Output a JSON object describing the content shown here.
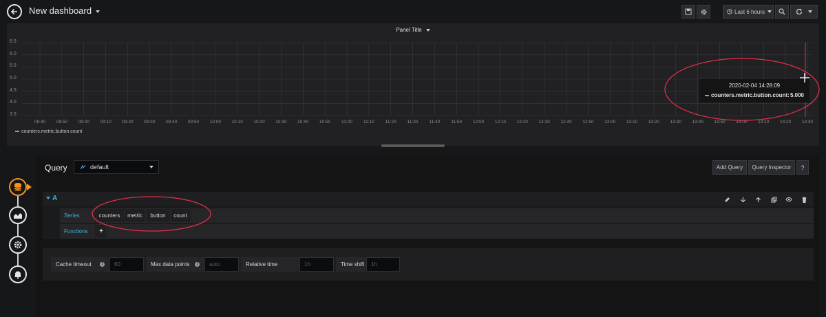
{
  "header": {
    "title": "New dashboard",
    "time_range": "Last 6 hours",
    "icons": [
      "save-icon",
      "gear-icon",
      "clock-icon",
      "zoom-out-icon",
      "refresh-icon"
    ]
  },
  "panel": {
    "title": "Panel Title",
    "legend": "counters.metric.button.count",
    "tooltip": {
      "time": "2020-02-04 14:28:09",
      "series": "counters.metric.button.count:",
      "value": "5.000"
    }
  },
  "chart_data": {
    "type": "line",
    "series": [
      {
        "name": "counters.metric.button.count",
        "x": [
          "14:28"
        ],
        "values": [
          5.0
        ]
      }
    ],
    "y_ticks": [
      "6.5",
      "6.0",
      "5.5",
      "5.0",
      "4.5",
      "4.0",
      "3.5"
    ],
    "x_ticks": [
      "08:40",
      "08:50",
      "09:00",
      "09:10",
      "09:20",
      "09:30",
      "09:40",
      "09:50",
      "10:00",
      "10:10",
      "10:20",
      "10:30",
      "10:40",
      "10:50",
      "11:00",
      "11:10",
      "11:20",
      "11:30",
      "11:40",
      "11:50",
      "12:00",
      "12:10",
      "12:20",
      "12:30",
      "12:40",
      "12:50",
      "13:00",
      "13:10",
      "13:20",
      "13:30",
      "13:40",
      "13:50",
      "14:00",
      "14:10",
      "14:20",
      "14:30"
    ],
    "ylim": [
      3.5,
      6.5
    ],
    "grid": true,
    "legend_position": "bottom-left",
    "colors": {
      "series": "#7eb26d",
      "annotation": "#e02f44"
    }
  },
  "query": {
    "label": "Query",
    "datasource": "default",
    "add_query": "Add Query",
    "query_inspector": "Query Inspector",
    "help": "?",
    "row_name": "A",
    "series_label": "Series",
    "segments": [
      "counters",
      "metric",
      "button",
      "count"
    ],
    "functions_label": "Functions",
    "add_function": "+",
    "options": {
      "cache_timeout_label": "Cache timeout",
      "cache_timeout_placeholder": "60",
      "max_data_points_label": "Max data points",
      "max_data_points_placeholder": "auto",
      "relative_time_label": "Relative time",
      "relative_time_placeholder": "1h",
      "time_shift_label": "Time shift",
      "time_shift_placeholder": "1h"
    }
  },
  "sidebar": {
    "icons": [
      "database-icon",
      "visualization-icon",
      "settings-icon",
      "alert-bell-icon"
    ]
  }
}
